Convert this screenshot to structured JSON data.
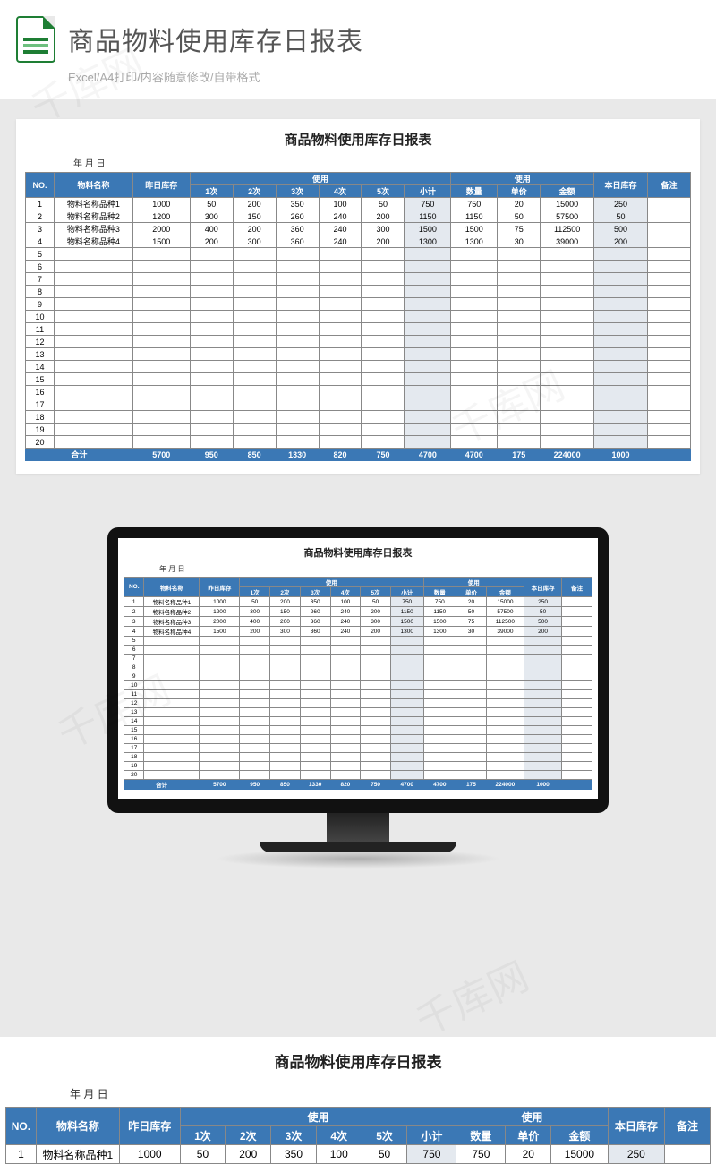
{
  "header": {
    "page_title": "商品物料使用库存日报表",
    "subtitle": "Excel/A4打印/内容随意修改/自带格式"
  },
  "sheet": {
    "title": "商品物料使用库存日报表",
    "date_label": "年  月  日",
    "cols": {
      "no": "NO.",
      "name": "物料名称",
      "prev": "昨日库存",
      "use_group": "使用",
      "u1": "1次",
      "u2": "2次",
      "u3": "3次",
      "u4": "4次",
      "u5": "5次",
      "subtotal": "小计",
      "use_group2": "使用",
      "qty": "数量",
      "price": "单价",
      "amount": "金额",
      "today": "本日库存",
      "remark": "备注"
    },
    "rows": [
      {
        "no": "1",
        "name": "物料名称品种1",
        "prev": "1000",
        "u1": "50",
        "u2": "200",
        "u3": "350",
        "u4": "100",
        "u5": "50",
        "sub": "750",
        "qty": "750",
        "pr": "20",
        "amt": "15000",
        "today": "250",
        "rem": ""
      },
      {
        "no": "2",
        "name": "物料名称品种2",
        "prev": "1200",
        "u1": "300",
        "u2": "150",
        "u3": "260",
        "u4": "240",
        "u5": "200",
        "sub": "1150",
        "qty": "1150",
        "pr": "50",
        "amt": "57500",
        "today": "50",
        "rem": ""
      },
      {
        "no": "3",
        "name": "物料名称品种3",
        "prev": "2000",
        "u1": "400",
        "u2": "200",
        "u3": "360",
        "u4": "240",
        "u5": "300",
        "sub": "1500",
        "qty": "1500",
        "pr": "75",
        "amt": "112500",
        "today": "500",
        "rem": ""
      },
      {
        "no": "4",
        "name": "物料名称品种4",
        "prev": "1500",
        "u1": "200",
        "u2": "300",
        "u3": "360",
        "u4": "240",
        "u5": "200",
        "sub": "1300",
        "qty": "1300",
        "pr": "30",
        "amt": "39000",
        "today": "200",
        "rem": ""
      }
    ],
    "empty_rows": [
      "5",
      "6",
      "7",
      "8",
      "9",
      "10",
      "11",
      "12",
      "13",
      "14",
      "15",
      "16",
      "17",
      "18",
      "19",
      "20"
    ],
    "total": {
      "label": "合计",
      "prev": "5700",
      "u1": "950",
      "u2": "850",
      "u3": "1330",
      "u4": "820",
      "u5": "750",
      "sub": "4700",
      "qty": "4700",
      "pr": "175",
      "amt": "224000",
      "today": "1000",
      "rem": ""
    }
  },
  "watermark": "千库网",
  "chart_data": {
    "type": "table",
    "title": "商品物料使用库存日报表",
    "columns": [
      "NO.",
      "物料名称",
      "昨日库存",
      "1次",
      "2次",
      "3次",
      "4次",
      "5次",
      "小计",
      "数量",
      "单价",
      "金额",
      "本日库存",
      "备注"
    ],
    "rows": [
      [
        1,
        "物料名称品种1",
        1000,
        50,
        200,
        350,
        100,
        50,
        750,
        750,
        20,
        15000,
        250,
        ""
      ],
      [
        2,
        "物料名称品种2",
        1200,
        300,
        150,
        260,
        240,
        200,
        1150,
        1150,
        50,
        57500,
        50,
        ""
      ],
      [
        3,
        "物料名称品种3",
        2000,
        400,
        200,
        360,
        240,
        300,
        1500,
        1500,
        75,
        112500,
        500,
        ""
      ],
      [
        4,
        "物料名称品种4",
        1500,
        200,
        300,
        360,
        240,
        200,
        1300,
        1300,
        30,
        39000,
        200,
        ""
      ]
    ],
    "total_row": [
      "合计",
      "",
      5700,
      950,
      850,
      1330,
      820,
      750,
      4700,
      4700,
      175,
      224000,
      1000,
      ""
    ]
  }
}
